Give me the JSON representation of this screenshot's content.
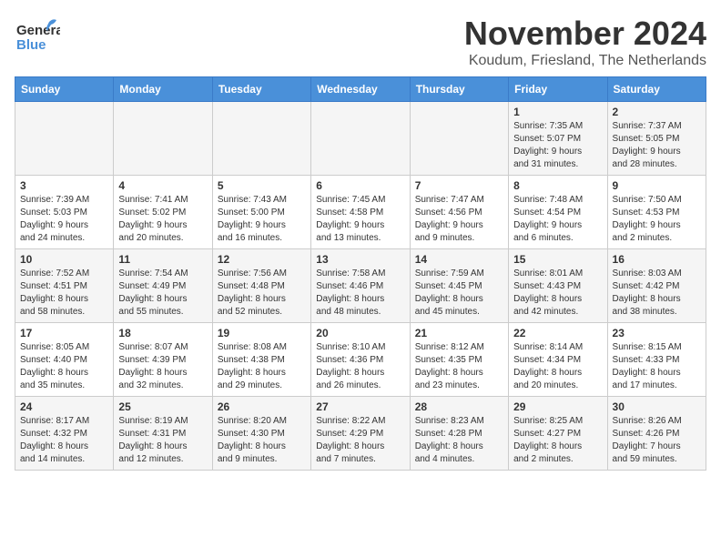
{
  "logo": {
    "general": "General",
    "blue": "Blue"
  },
  "header": {
    "month": "November 2024",
    "location": "Koudum, Friesland, The Netherlands"
  },
  "weekdays": [
    "Sunday",
    "Monday",
    "Tuesday",
    "Wednesday",
    "Thursday",
    "Friday",
    "Saturday"
  ],
  "weeks": [
    {
      "days": [
        {
          "number": "",
          "info": ""
        },
        {
          "number": "",
          "info": ""
        },
        {
          "number": "",
          "info": ""
        },
        {
          "number": "",
          "info": ""
        },
        {
          "number": "",
          "info": ""
        },
        {
          "number": "1",
          "info": "Sunrise: 7:35 AM\nSunset: 5:07 PM\nDaylight: 9 hours\nand 31 minutes."
        },
        {
          "number": "2",
          "info": "Sunrise: 7:37 AM\nSunset: 5:05 PM\nDaylight: 9 hours\nand 28 minutes."
        }
      ]
    },
    {
      "days": [
        {
          "number": "3",
          "info": "Sunrise: 7:39 AM\nSunset: 5:03 PM\nDaylight: 9 hours\nand 24 minutes."
        },
        {
          "number": "4",
          "info": "Sunrise: 7:41 AM\nSunset: 5:02 PM\nDaylight: 9 hours\nand 20 minutes."
        },
        {
          "number": "5",
          "info": "Sunrise: 7:43 AM\nSunset: 5:00 PM\nDaylight: 9 hours\nand 16 minutes."
        },
        {
          "number": "6",
          "info": "Sunrise: 7:45 AM\nSunset: 4:58 PM\nDaylight: 9 hours\nand 13 minutes."
        },
        {
          "number": "7",
          "info": "Sunrise: 7:47 AM\nSunset: 4:56 PM\nDaylight: 9 hours\nand 9 minutes."
        },
        {
          "number": "8",
          "info": "Sunrise: 7:48 AM\nSunset: 4:54 PM\nDaylight: 9 hours\nand 6 minutes."
        },
        {
          "number": "9",
          "info": "Sunrise: 7:50 AM\nSunset: 4:53 PM\nDaylight: 9 hours\nand 2 minutes."
        }
      ]
    },
    {
      "days": [
        {
          "number": "10",
          "info": "Sunrise: 7:52 AM\nSunset: 4:51 PM\nDaylight: 8 hours\nand 58 minutes."
        },
        {
          "number": "11",
          "info": "Sunrise: 7:54 AM\nSunset: 4:49 PM\nDaylight: 8 hours\nand 55 minutes."
        },
        {
          "number": "12",
          "info": "Sunrise: 7:56 AM\nSunset: 4:48 PM\nDaylight: 8 hours\nand 52 minutes."
        },
        {
          "number": "13",
          "info": "Sunrise: 7:58 AM\nSunset: 4:46 PM\nDaylight: 8 hours\nand 48 minutes."
        },
        {
          "number": "14",
          "info": "Sunrise: 7:59 AM\nSunset: 4:45 PM\nDaylight: 8 hours\nand 45 minutes."
        },
        {
          "number": "15",
          "info": "Sunrise: 8:01 AM\nSunset: 4:43 PM\nDaylight: 8 hours\nand 42 minutes."
        },
        {
          "number": "16",
          "info": "Sunrise: 8:03 AM\nSunset: 4:42 PM\nDaylight: 8 hours\nand 38 minutes."
        }
      ]
    },
    {
      "days": [
        {
          "number": "17",
          "info": "Sunrise: 8:05 AM\nSunset: 4:40 PM\nDaylight: 8 hours\nand 35 minutes."
        },
        {
          "number": "18",
          "info": "Sunrise: 8:07 AM\nSunset: 4:39 PM\nDaylight: 8 hours\nand 32 minutes."
        },
        {
          "number": "19",
          "info": "Sunrise: 8:08 AM\nSunset: 4:38 PM\nDaylight: 8 hours\nand 29 minutes."
        },
        {
          "number": "20",
          "info": "Sunrise: 8:10 AM\nSunset: 4:36 PM\nDaylight: 8 hours\nand 26 minutes."
        },
        {
          "number": "21",
          "info": "Sunrise: 8:12 AM\nSunset: 4:35 PM\nDaylight: 8 hours\nand 23 minutes."
        },
        {
          "number": "22",
          "info": "Sunrise: 8:14 AM\nSunset: 4:34 PM\nDaylight: 8 hours\nand 20 minutes."
        },
        {
          "number": "23",
          "info": "Sunrise: 8:15 AM\nSunset: 4:33 PM\nDaylight: 8 hours\nand 17 minutes."
        }
      ]
    },
    {
      "days": [
        {
          "number": "24",
          "info": "Sunrise: 8:17 AM\nSunset: 4:32 PM\nDaylight: 8 hours\nand 14 minutes."
        },
        {
          "number": "25",
          "info": "Sunrise: 8:19 AM\nSunset: 4:31 PM\nDaylight: 8 hours\nand 12 minutes."
        },
        {
          "number": "26",
          "info": "Sunrise: 8:20 AM\nSunset: 4:30 PM\nDaylight: 8 hours\nand 9 minutes."
        },
        {
          "number": "27",
          "info": "Sunrise: 8:22 AM\nSunset: 4:29 PM\nDaylight: 8 hours\nand 7 minutes."
        },
        {
          "number": "28",
          "info": "Sunrise: 8:23 AM\nSunset: 4:28 PM\nDaylight: 8 hours\nand 4 minutes."
        },
        {
          "number": "29",
          "info": "Sunrise: 8:25 AM\nSunset: 4:27 PM\nDaylight: 8 hours\nand 2 minutes."
        },
        {
          "number": "30",
          "info": "Sunrise: 8:26 AM\nSunset: 4:26 PM\nDaylight: 7 hours\nand 59 minutes."
        }
      ]
    }
  ]
}
